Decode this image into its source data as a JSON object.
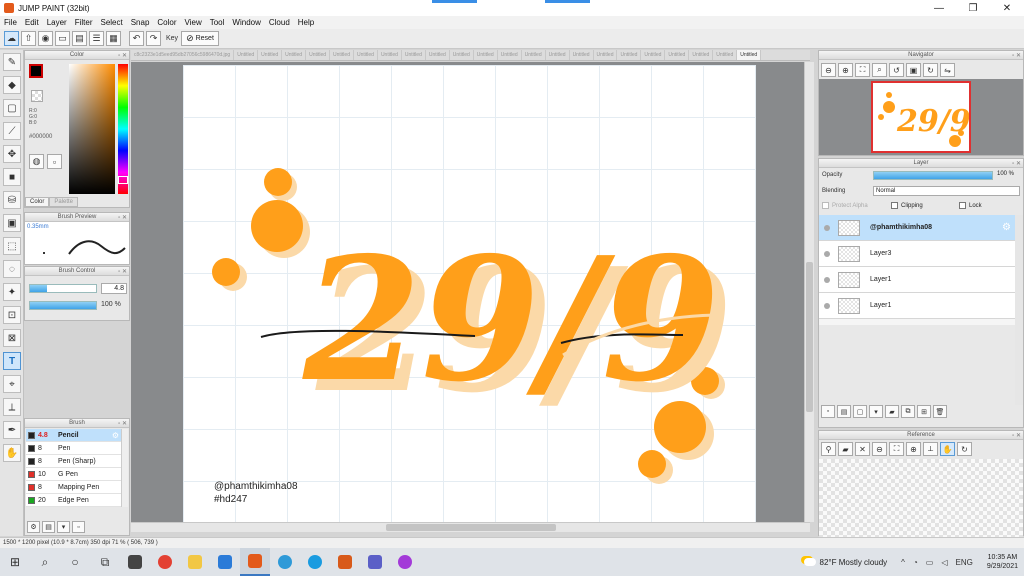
{
  "window": {
    "title": "JUMP PAINT (32bit)",
    "controls": [
      "—",
      "❐",
      "✕"
    ]
  },
  "menu": [
    "File",
    "Edit",
    "Layer",
    "Filter",
    "Select",
    "Snap",
    "Color",
    "View",
    "Tool",
    "Window",
    "Cloud",
    "Help"
  ],
  "toolbar": {
    "key_label": "Key",
    "reset_label": "Reset"
  },
  "panels": {
    "color": {
      "title": "Color",
      "rgb": [
        "R:0",
        "G:0",
        "B:0"
      ],
      "hex": "#000000",
      "tabs": [
        "Color",
        "Palette"
      ]
    },
    "brush_preview": {
      "title": "Brush Preview",
      "size": "0.35mm"
    },
    "brush_control": {
      "title": "Brush Control",
      "size_value": "4.8",
      "size_fraction": 0.25,
      "opacity_value": "100 %",
      "opacity_fraction": 1.0
    },
    "brush": {
      "title": "Brush",
      "items": [
        {
          "size": "4.8",
          "name": "Pencil",
          "color": "#222222"
        },
        {
          "size": "8",
          "name": "Pen",
          "color": "#222222"
        },
        {
          "size": "8",
          "name": "Pen (Sharp)",
          "color": "#222222"
        },
        {
          "size": "10",
          "name": "G Pen",
          "color": "#e0302a"
        },
        {
          "size": "8",
          "name": "Mapping Pen",
          "color": "#e0302a"
        },
        {
          "size": "20",
          "name": "Edge Pen",
          "color": "#1aa821"
        }
      ]
    },
    "navigator": {
      "title": "Navigator"
    },
    "layer": {
      "title": "Layer",
      "opacity_label": "Opacity",
      "opacity_value": "100 %",
      "opacity_fraction": 1.0,
      "blending_label": "Blending",
      "blending_value": "Normal",
      "protect_alpha": "Protect Alpha",
      "clipping": "Clipping",
      "lock": "Lock",
      "layers": [
        {
          "name": "@phamthikimha08"
        },
        {
          "name": "Layer3"
        },
        {
          "name": "Layer1"
        },
        {
          "name": "Layer1"
        }
      ]
    },
    "reference": {
      "title": "Reference"
    }
  },
  "document_tabs": [
    "c8c2323e1d5eed95db27056c5986470d.jpg",
    "Untitled",
    "Untitled",
    "Untitled",
    "Untitled",
    "Untitled",
    "Untitled",
    "Untitled",
    "Untitled",
    "Untitled",
    "Untitled",
    "Untitled",
    "Untitled",
    "Untitled",
    "Untitled",
    "Untitled",
    "Untitled",
    "Untitled",
    "Untitled",
    "Untitled",
    "Untitled",
    "Untitled",
    "Untitled"
  ],
  "canvas": {
    "lettering": "29/9",
    "credit_line1": "@phamthikimha08",
    "credit_line2": "#hd247",
    "accent": "#ff9f1a",
    "shadow": "#fbd9a8"
  },
  "status": "1500 * 1200 pixel   (10.9 * 8.7cm)   350 dpi   71 %   ( 506, 739 )",
  "taskbar": {
    "weather": "82°F  Mostly cloudy",
    "lang": "ENG",
    "time": "10:35 AM",
    "date": "9/29/2021"
  }
}
